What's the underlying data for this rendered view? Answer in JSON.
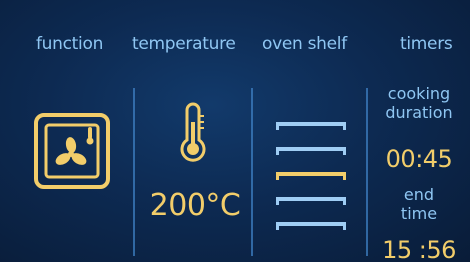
{
  "header": {
    "function": "function",
    "temperature": "temperature",
    "oven_shelf": "oven shelf",
    "timers": "timers"
  },
  "function": {
    "icon": "fan-oven-icon"
  },
  "temperature": {
    "icon": "thermometer-icon",
    "value": "200°C"
  },
  "oven_shelf": {
    "levels": 5,
    "selected_level": 3
  },
  "timers": {
    "cooking_label_1": "cooking",
    "cooking_label_2": "duration",
    "cooking_value": "00:45",
    "end_label_1": "end",
    "end_label_2": "time",
    "end_value": "15 :56"
  },
  "colors": {
    "background": "#0d2a52",
    "label": "#8fc6f2",
    "accent": "#f2cd6a"
  }
}
